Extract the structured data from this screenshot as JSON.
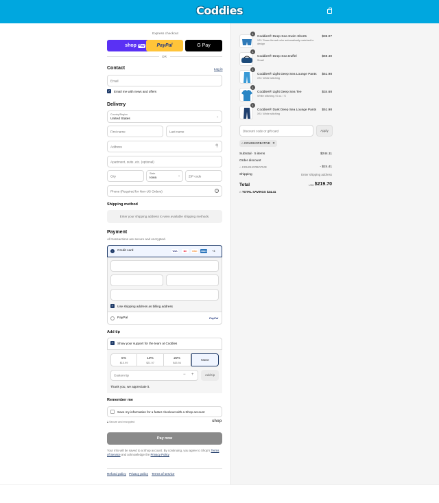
{
  "brand": {
    "name": "Coddies"
  },
  "colors": {
    "header": "#00a7df",
    "shop_pay": "#5a31f4",
    "paypal": "#ffc439",
    "accent": "#1e3a68"
  },
  "express": {
    "title": "Express checkout",
    "shop_pay_label": "shop",
    "shop_pay_tag": "Pay",
    "paypal_label": "PayPal",
    "gpay_label": "G Pay",
    "or_label": "OR"
  },
  "contact": {
    "title": "Contact",
    "login_label": "Log in",
    "email_placeholder": "Email",
    "newsletter_label": "Email me with news and offers"
  },
  "delivery": {
    "title": "Delivery",
    "country_label": "Country/Region",
    "country_value": "United States",
    "first_name_placeholder": "First name",
    "last_name_placeholder": "Last name",
    "address_placeholder": "Address",
    "apartment_placeholder": "Apartment, suite, etc. (optional)",
    "city_placeholder": "City",
    "state_label": "State",
    "state_value": "Iowa",
    "zip_placeholder": "ZIP code",
    "phone_placeholder": "Phone (Required for Non-US Orders)"
  },
  "shipping_method": {
    "title": "Shipping method",
    "message": "Enter your shipping address to view available shipping methods."
  },
  "payment": {
    "title": "Payment",
    "subtitle": "All transactions are secure and encrypted.",
    "credit_card_label": "Credit card",
    "card_logos": [
      "VISA",
      "MC",
      "DISC",
      "AMEX"
    ],
    "more_cards": "+4",
    "billing_same_label": "Use shipping address as billing address",
    "paypal_option_label": "PayPal",
    "paypal_logo": "PayPal"
  },
  "tip": {
    "title": "Add tip",
    "support_label": "Show your support for the team at Coddies",
    "options": [
      {
        "pct": "5%",
        "amount": "$10.99"
      },
      {
        "pct": "10%",
        "amount": "$21.97"
      },
      {
        "pct": "20%",
        "amount": "$43.94"
      },
      {
        "pct": "None",
        "amount": ""
      }
    ],
    "custom_placeholder": "Custom tip",
    "add_tip_label": "Add tip",
    "thanks": "Thank you, we appreciate it."
  },
  "remember": {
    "title": "Remember me",
    "save_label": "Save my information for a faster checkout with a Shop account",
    "secure_label": "Secure and encrypted",
    "shop_logo": "shop"
  },
  "pay_now_label": "Pay now",
  "legal": {
    "text1": "Your info will be saved to a Shop account. By continuing, you agree to Shop's",
    "terms_label": "Terms of Service",
    "text2": "and acknowledge the",
    "privacy_label": "Privacy Policy"
  },
  "footer_links": [
    "Refund policy",
    "Privacy policy",
    "Terms of service"
  ],
  "cart": {
    "items": [
      {
        "name": "Coddies® Deep Sea Swim Shorts",
        "variant": "XS / Seam thread color automatically matched to design",
        "price": "$36.07",
        "qty": "1"
      },
      {
        "name": "Coddies® Deep Sea Duffel",
        "variant": "Small",
        "price": "$69.40",
        "qty": "1"
      },
      {
        "name": "Coddies® Light Deep Sea Lounge Pants",
        "variant": "XS / White stitching",
        "price": "$51.98",
        "qty": "1"
      },
      {
        "name": "Coddies® Light Deep Sea Tee",
        "variant": "White stitching / 6 oz. / S",
        "price": "$34.68",
        "qty": "1"
      },
      {
        "name": "Coddies® Dark Deep Sea Lounge Pants",
        "variant": "XS / White stitching",
        "price": "$51.98",
        "qty": "1"
      }
    ],
    "discount_placeholder": "Discount code or gift card",
    "apply_label": "Apply",
    "applied_code": "COUGHCREATIVE",
    "subtotal_label": "Subtotal · 5 items",
    "subtotal_value": "$244.11",
    "order_discount_label": "Order discount",
    "discount_code": "COUGHCREATIVE",
    "discount_value": "- $24.41",
    "shipping_label": "Shipping",
    "shipping_value": "Enter shipping address",
    "total_label": "Total",
    "currency": "USD",
    "total_value": "$219.70",
    "savings_label": "TOTAL SAVINGS",
    "savings_value": "$24.41"
  }
}
